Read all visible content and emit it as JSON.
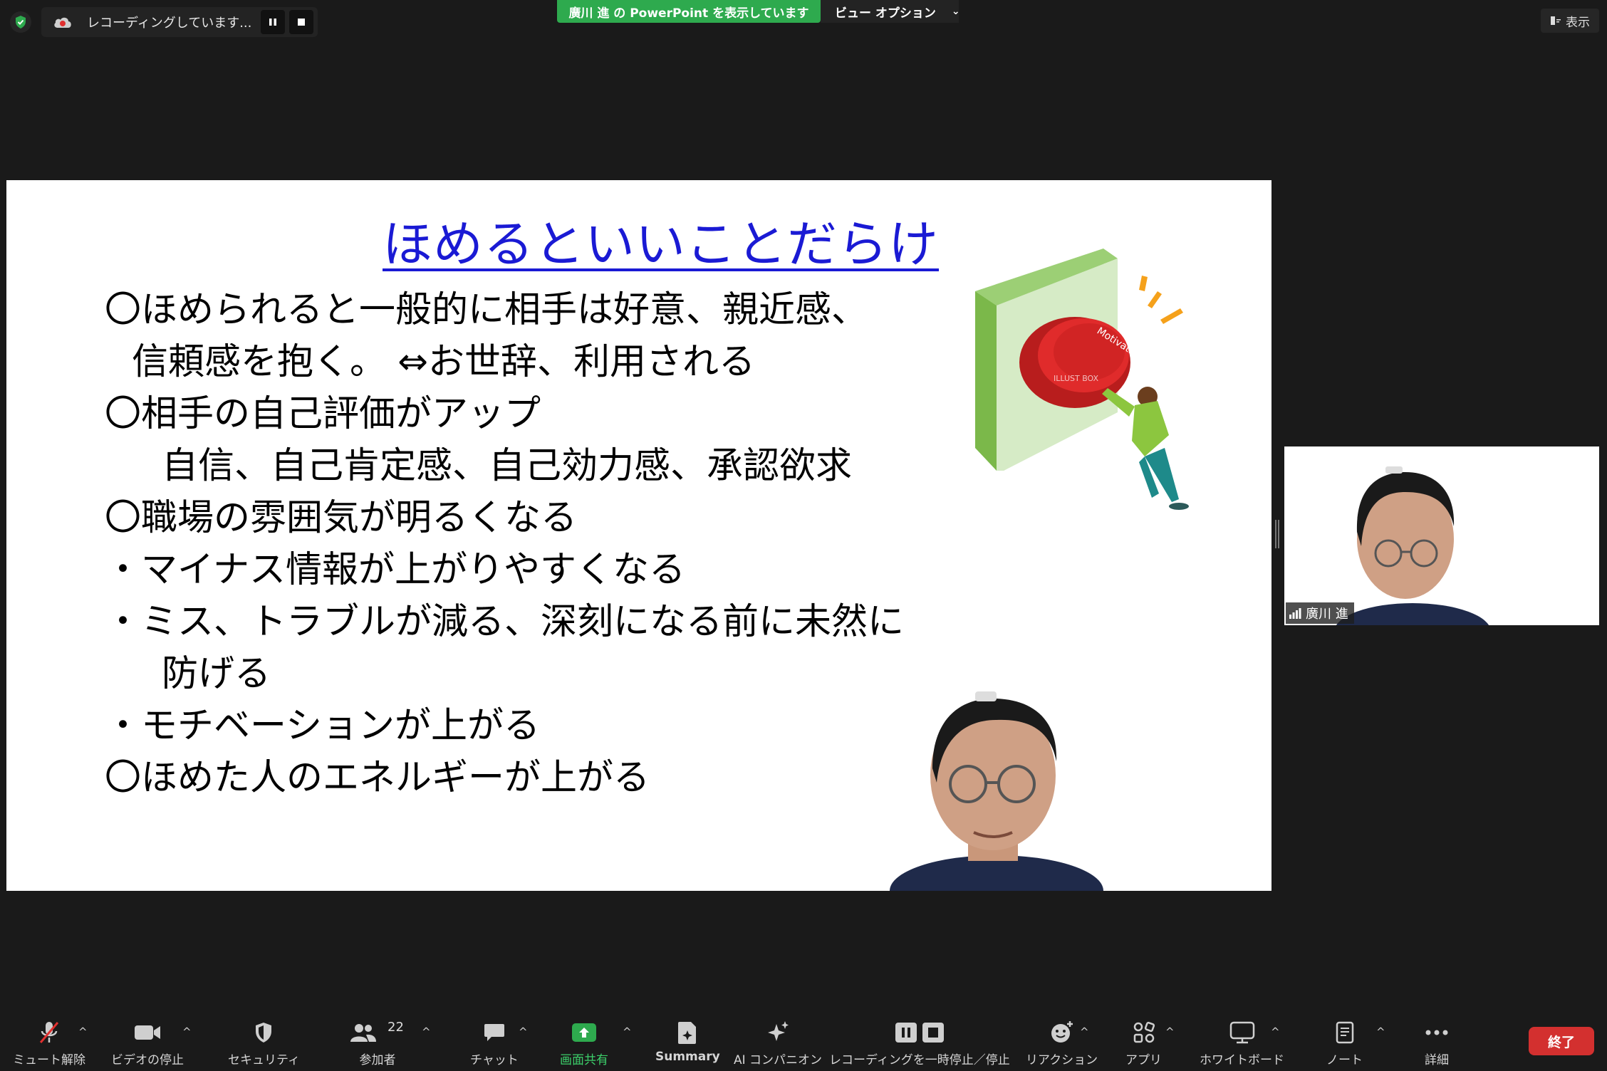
{
  "top": {
    "recording_status": "レコーディングしています...",
    "share_banner": "廣川 進 の PowerPoint を表示しています",
    "view_options": "ビュー オプション",
    "display_label": "表示"
  },
  "slide": {
    "title": "ほめるといいことだらけ",
    "lines": [
      "〇ほめられると一般的に相手は好意、親近感、",
      "信頼感を抱く。 ⇔お世辞、利用される",
      "〇相手の自己評価がアップ",
      "自信、自己肯定感、自己効力感、承認欲求",
      "〇職場の雰囲気が明るくなる",
      "・マイナス情報が上がりやすくなる",
      "・ミス、トラブルが減る、深刻になる前に未然に",
      "防げる",
      "・モチベーションが上がる",
      "〇ほめた人のエネルギーが上がる"
    ],
    "illustration_text": "Motivation",
    "illustration_watermark": "ILLUST BOX"
  },
  "self_view": {
    "name": "廣川 進"
  },
  "toolbar": {
    "mute": "ミュート解除",
    "video": "ビデオの停止",
    "security": "セキュリティ",
    "participants": "参加者",
    "participants_count": "22",
    "chat": "チャット",
    "share": "画面共有",
    "summary": "Summary",
    "ai": "AI コンパニオン",
    "record": "レコーディングを一時停止／停止",
    "reactions": "リアクション",
    "apps": "アプリ",
    "whiteboard": "ホワイトボード",
    "notes": "ノート",
    "more": "詳細",
    "end": "終了"
  },
  "colors": {
    "share_green": "#2eaa4e",
    "title_blue": "#1a1ad4",
    "end_red": "#d3302f",
    "background": "#1a1a1a"
  }
}
